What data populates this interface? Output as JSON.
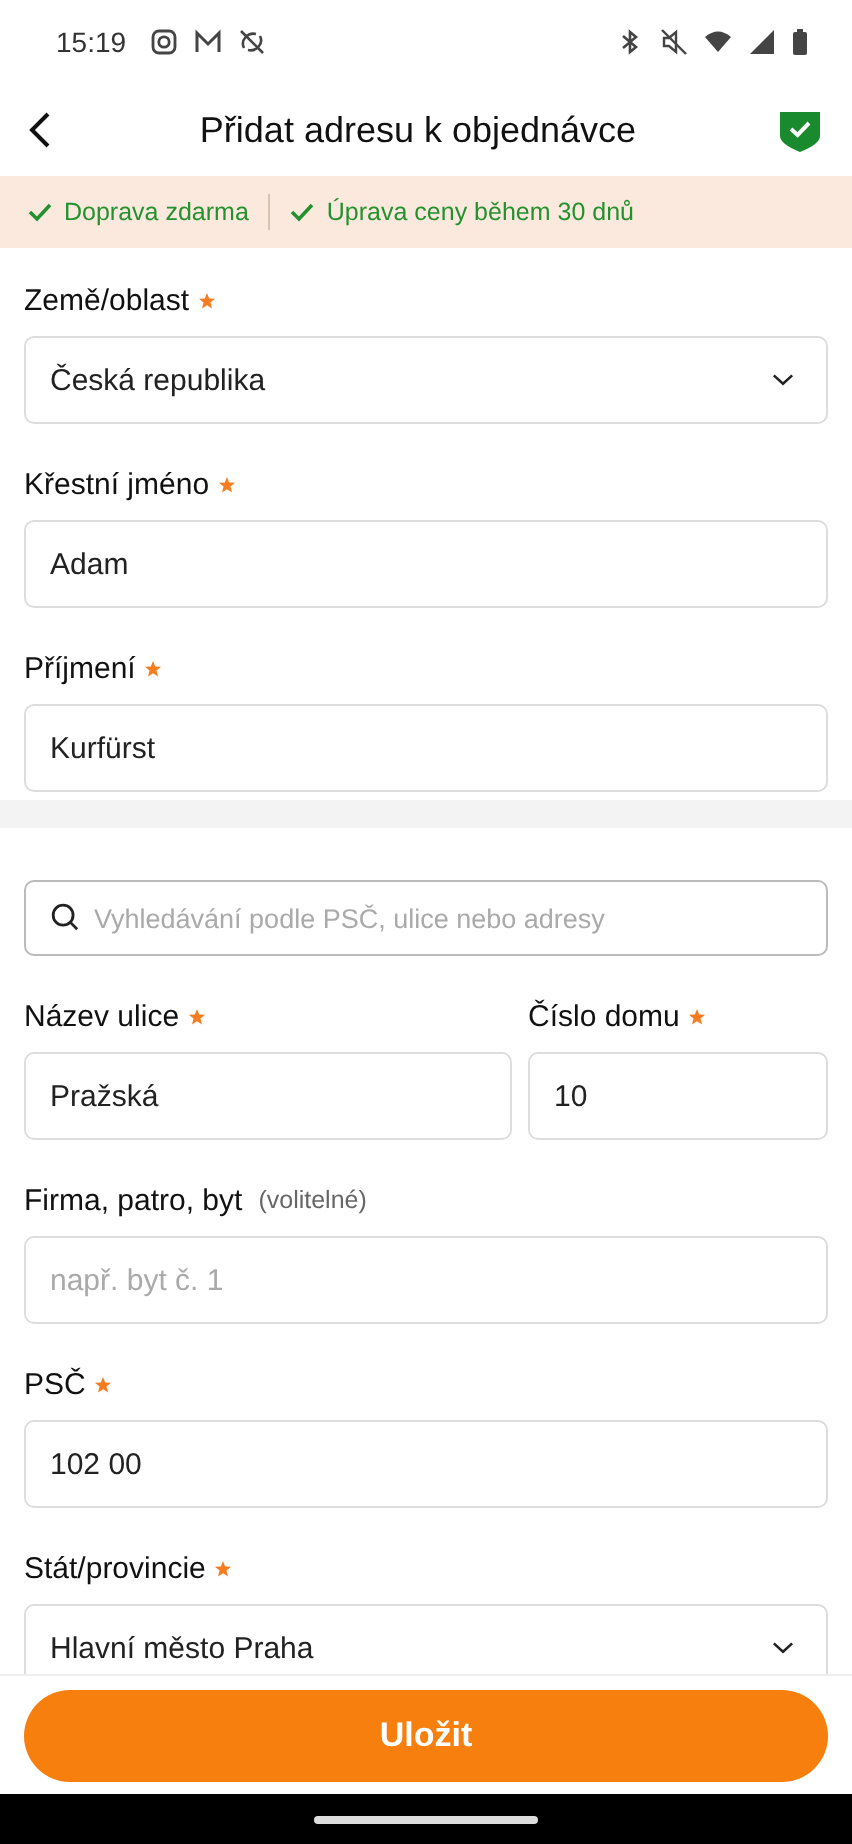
{
  "status_bar": {
    "time": "15:19"
  },
  "header": {
    "title": "Přidat adresu k objednávce"
  },
  "banner": [
    "Doprava zdarma",
    "Úprava ceny během 30 dnů"
  ],
  "personal_fields": [
    {
      "kind": "select",
      "label": "Země/oblast",
      "required": true,
      "value": "Česká republika"
    },
    {
      "kind": "text",
      "label": "Křestní jméno",
      "required": true,
      "value": "Adam"
    },
    {
      "kind": "text",
      "label": "Příjmení",
      "required": true,
      "value": "Kurfürst"
    }
  ],
  "address_search": {
    "placeholder": "Vyhledávání podle PSČ, ulice nebo adresy"
  },
  "address_rows": [
    [
      {
        "kind": "text",
        "label": "Název ulice",
        "required": true,
        "value": "Pražská"
      },
      {
        "kind": "text",
        "label": "Číslo domu",
        "required": true,
        "value": "10"
      }
    ],
    [
      {
        "kind": "text",
        "label": "Firma, patro, byt",
        "required": false,
        "note": "(volitelné)",
        "placeholder": "např. byt č. 1"
      }
    ],
    [
      {
        "kind": "text",
        "label": "PSČ",
        "required": true,
        "value": "102 00"
      }
    ],
    [
      {
        "kind": "select",
        "label": "Stát/provincie",
        "required": true,
        "value": "Hlavní město Praha"
      }
    ]
  ],
  "save_button": "Uložit"
}
